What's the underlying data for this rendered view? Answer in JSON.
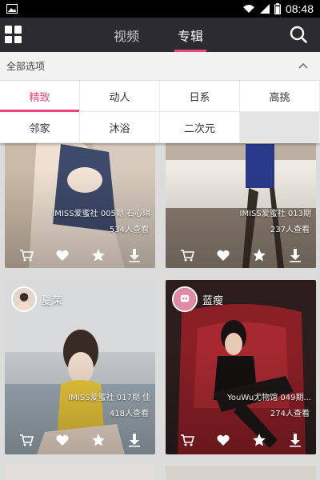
{
  "status_bar": {
    "time": "08:48",
    "icons": [
      "image-icon",
      "wifi-icon",
      "signal-icon",
      "battery-icon"
    ]
  },
  "nav": {
    "menu_icon": "grid-menu-icon",
    "tabs": [
      {
        "label": "视频",
        "active": false
      },
      {
        "label": "专辑",
        "active": true
      }
    ],
    "search_icon": "search-icon"
  },
  "categories": {
    "header": "全部选项",
    "collapse_icon": "chevron-up-icon",
    "items": [
      {
        "label": "精致",
        "active": true
      },
      {
        "label": "动人",
        "active": false
      },
      {
        "label": "日系",
        "active": false
      },
      {
        "label": "高挑",
        "active": false
      },
      {
        "label": "邻家",
        "active": false
      },
      {
        "label": "沐浴",
        "active": false
      },
      {
        "label": "二次元",
        "active": false
      }
    ]
  },
  "cards": [
    {
      "title": "IMISS爱蜜社 005期 石心琪",
      "views": "534人查看",
      "author": "",
      "theme": "#c9b8a6"
    },
    {
      "title": "IMISS爱蜜社 013期",
      "views": "237人查看",
      "author": "",
      "theme": "#b9aca0"
    },
    {
      "title": "IMISS爱蜜社 017期 佳",
      "views": "418人查看",
      "author": "夏茉",
      "theme": "#b8c1c7"
    },
    {
      "title": "YouWu尤物馆 049期...",
      "views": "274人查看",
      "author": "蓝瘦",
      "theme": "#7c2a2e"
    }
  ],
  "card_actions": [
    "cart-icon",
    "heart-icon",
    "star-icon",
    "download-icon"
  ],
  "colors": {
    "accent": "#e8467c",
    "nav_bg": "#2b2b30"
  }
}
